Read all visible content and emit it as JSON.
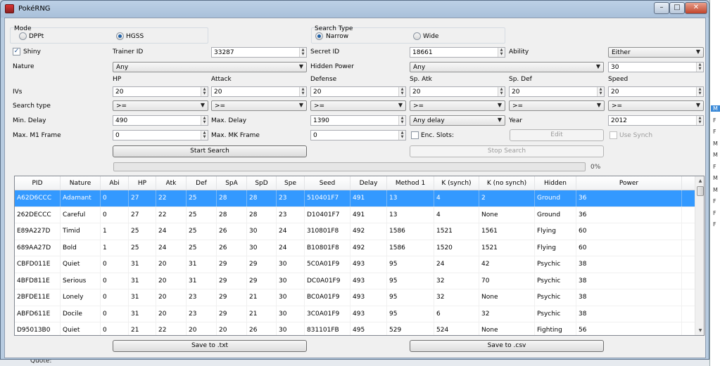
{
  "window": {
    "title": "PokéRNG"
  },
  "background": {
    "bottom_text": "Quote:",
    "right_rows": [
      "M",
      "F",
      "F",
      "M",
      "M",
      "F",
      "M",
      "M",
      "F",
      "F",
      "F"
    ]
  },
  "mode": {
    "label": "Mode",
    "options": [
      "DPPt",
      "HGSS"
    ],
    "selected": "HGSS"
  },
  "search_type": {
    "label": "Search Type",
    "options": [
      "Narrow",
      "Wide"
    ],
    "selected": "Narrow"
  },
  "form": {
    "shiny_label": "Shiny",
    "shiny_checked": true,
    "trainer_id_label": "Trainer ID",
    "trainer_id": "33287",
    "secret_id_label": "Secret ID",
    "secret_id": "18661",
    "ability_label": "Ability",
    "ability": "Either",
    "nature_label": "Nature",
    "nature": "Any",
    "hidden_power_label": "Hidden Power",
    "hidden_power": "Any",
    "hidden_power_value": "30",
    "iv_label": "IVs",
    "search_type_label": "Search type",
    "stats": [
      {
        "label": "HP",
        "iv": "20",
        "op": ">="
      },
      {
        "label": "Attack",
        "iv": "20",
        "op": ">="
      },
      {
        "label": "Defense",
        "iv": "20",
        "op": ">="
      },
      {
        "label": "Sp. Atk",
        "iv": "20",
        "op": ">="
      },
      {
        "label": "Sp. Def",
        "iv": "20",
        "op": ">="
      },
      {
        "label": "Speed",
        "iv": "20",
        "op": ">="
      }
    ],
    "min_delay_label": "Min. Delay",
    "min_delay": "490",
    "max_delay_label": "Max. Delay",
    "max_delay": "1390",
    "delay_type": "Any delay",
    "year_label": "Year",
    "year": "2012",
    "max_m1_label": "Max. M1 Frame",
    "max_m1": "0",
    "max_mk_label": "Max. MK Frame",
    "max_mk": "0",
    "enc_slots_label": "Enc. Slots:",
    "edit_label": "Edit",
    "use_synch_label": "Use Synch",
    "start_search_label": "Start Search",
    "stop_search_label": "Stop Search",
    "progress_percent": "0%",
    "progress_value": 0
  },
  "table": {
    "columns": [
      "PID",
      "Nature",
      "Abi",
      "HP",
      "Atk",
      "Def",
      "SpA",
      "SpD",
      "Spe",
      "Seed",
      "Delay",
      "Method 1",
      "K (synch)",
      "K (no synch)",
      "Hidden",
      "Power"
    ],
    "rows": [
      [
        "A62D6CCC",
        "Adamant",
        "0",
        "27",
        "22",
        "25",
        "28",
        "28",
        "23",
        "510401F7",
        "491",
        "13",
        "4",
        "2",
        "Ground",
        "36"
      ],
      [
        "262DECCC",
        "Careful",
        "0",
        "27",
        "22",
        "25",
        "28",
        "28",
        "23",
        "D10401F7",
        "491",
        "13",
        "4",
        "None",
        "Ground",
        "36"
      ],
      [
        "E89A227D",
        "Timid",
        "1",
        "25",
        "24",
        "25",
        "26",
        "30",
        "24",
        "310801F8",
        "492",
        "1586",
        "1521",
        "1561",
        "Flying",
        "60"
      ],
      [
        "689AA27D",
        "Bold",
        "1",
        "25",
        "24",
        "25",
        "26",
        "30",
        "24",
        "B10801F8",
        "492",
        "1586",
        "1520",
        "1521",
        "Flying",
        "60"
      ],
      [
        "CBFD011E",
        "Quiet",
        "0",
        "31",
        "20",
        "31",
        "29",
        "29",
        "30",
        "5C0A01F9",
        "493",
        "95",
        "24",
        "42",
        "Psychic",
        "38"
      ],
      [
        "4BFD811E",
        "Serious",
        "0",
        "31",
        "20",
        "31",
        "29",
        "29",
        "30",
        "DC0A01F9",
        "493",
        "95",
        "32",
        "70",
        "Psychic",
        "38"
      ],
      [
        "2BFDE11E",
        "Lonely",
        "0",
        "31",
        "20",
        "23",
        "29",
        "21",
        "30",
        "BC0A01F9",
        "493",
        "95",
        "32",
        "None",
        "Psychic",
        "38"
      ],
      [
        "ABFD611E",
        "Docile",
        "0",
        "31",
        "20",
        "23",
        "29",
        "21",
        "30",
        "3C0A01F9",
        "493",
        "95",
        "6",
        "32",
        "Psychic",
        "38"
      ],
      [
        "D95013B0",
        "Quiet",
        "0",
        "21",
        "22",
        "20",
        "20",
        "26",
        "30",
        "831101FB",
        "495",
        "529",
        "524",
        "None",
        "Fighting",
        "56"
      ]
    ]
  },
  "save_txt_label": "Save to .txt",
  "save_csv_label": "Save to .csv"
}
